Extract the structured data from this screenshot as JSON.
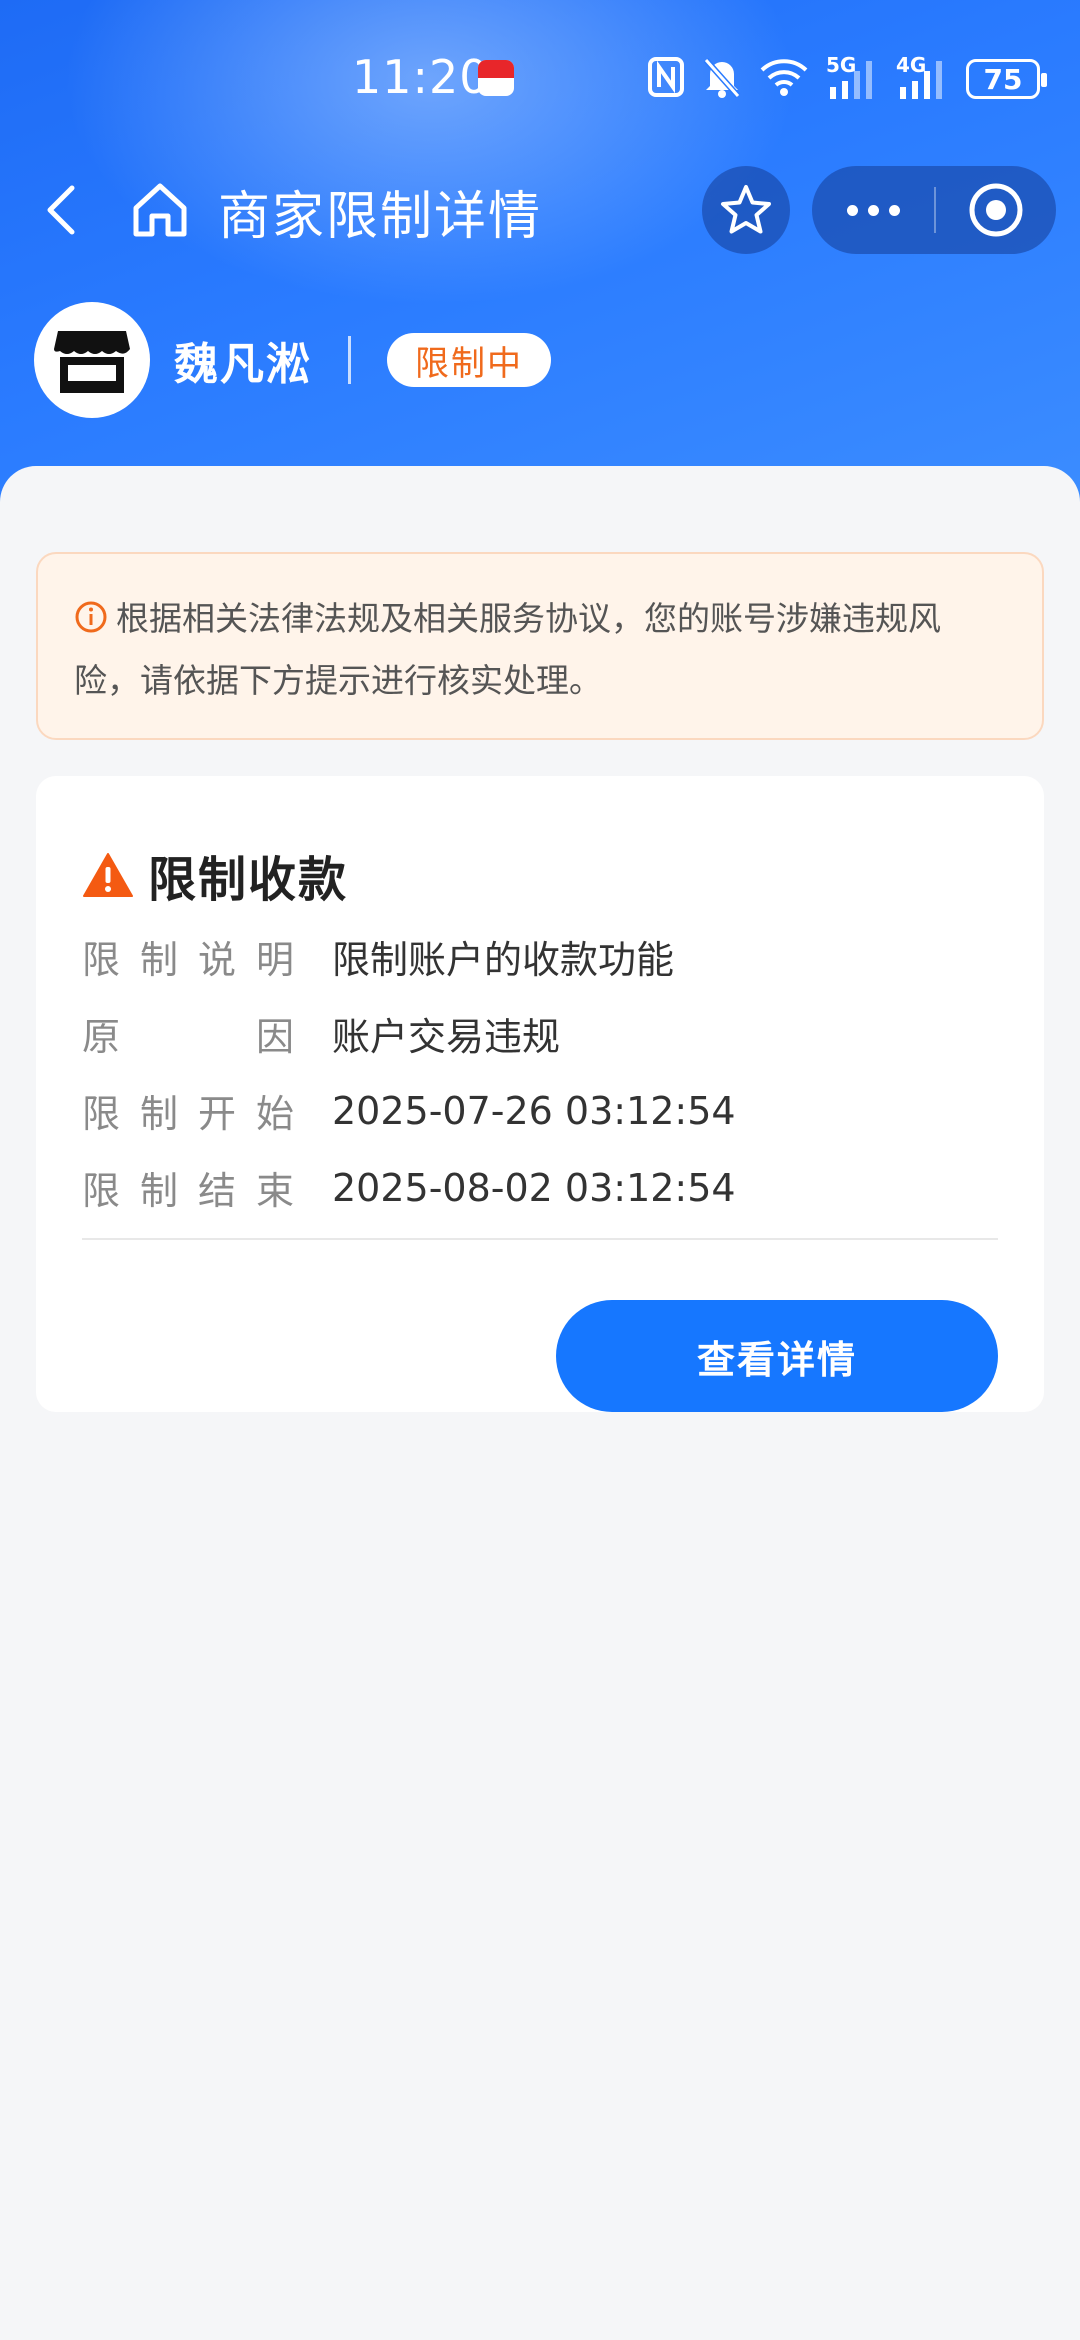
{
  "status_bar": {
    "time": "11:20",
    "network_1": "5G",
    "network_2": "4G",
    "battery": "75"
  },
  "navbar": {
    "title": "商家限制详情"
  },
  "merchant": {
    "name": "魏凡淞",
    "status": "限制中"
  },
  "notice": {
    "text": "根据相关法律法规及相关服务协议，您的账号涉嫌违规风险，请依据下方提示进行核实处理。"
  },
  "restriction": {
    "title": "限制收款",
    "rows": [
      {
        "label": "限制说明",
        "value": "限制账户的收款功能"
      },
      {
        "label": "原因",
        "value": "账户交易违规"
      },
      {
        "label": "限制开始",
        "value": "2025-07-26 03:12:54"
      },
      {
        "label": "限制结束",
        "value": "2025-08-02 03:12:54"
      }
    ],
    "button_label": "查看详情"
  },
  "colors": {
    "primary": "#1677ff",
    "header": "#2a7bff",
    "warning": "#f06a1c",
    "notice_bg": "#fff4ea"
  }
}
